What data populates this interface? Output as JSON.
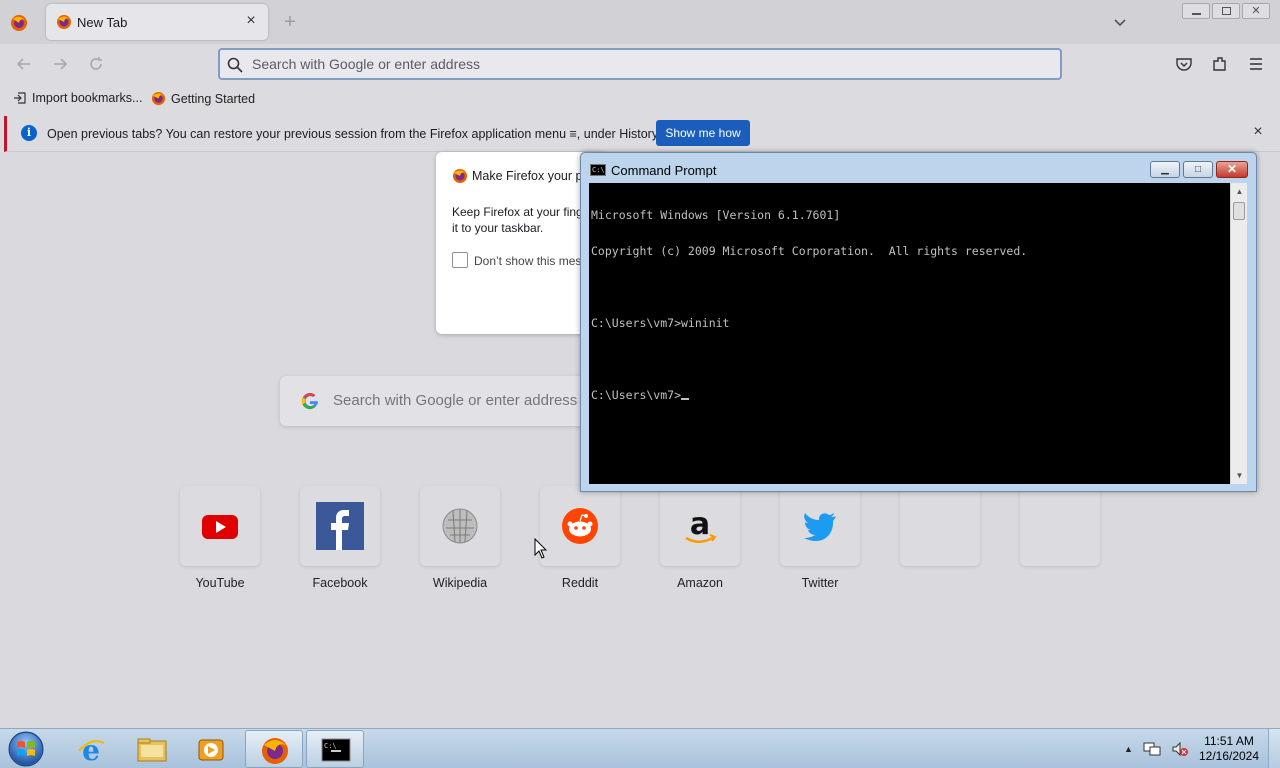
{
  "firefox": {
    "tab": {
      "title": "New Tab"
    },
    "urlbar": {
      "placeholder": "Search with Google or enter address"
    },
    "bookmarks": [
      {
        "label": "Import bookmarks..."
      },
      {
        "label": "Getting Started"
      }
    ],
    "notification": {
      "message": "Open previous tabs? You can restore your previous session from the Firefox application menu ≡, under History.",
      "button": "Show me how"
    },
    "default_browser_dialog": {
      "title": "Make Firefox your pr",
      "body_line1": "Keep Firefox at your fing",
      "body_line2": "it to your taskbar.",
      "checkbox_label": "Don’t show this mes"
    },
    "newtab_search": {
      "placeholder": "Search with Google or enter address"
    },
    "top_sites": [
      {
        "label": "YouTube",
        "icon": "youtube-icon"
      },
      {
        "label": "Facebook",
        "icon": "facebook-icon"
      },
      {
        "label": "Wikipedia",
        "icon": "wikipedia-icon"
      },
      {
        "label": "Reddit",
        "icon": "reddit-icon"
      },
      {
        "label": "Amazon",
        "icon": "amazon-icon"
      },
      {
        "label": "Twitter",
        "icon": "twitter-icon"
      },
      {
        "label": ""
      },
      {
        "label": ""
      }
    ]
  },
  "cmd": {
    "title": "Command Prompt",
    "lines": [
      "Microsoft Windows [Version 6.1.7601]",
      "Copyright (c) 2009 Microsoft Corporation.  All rights reserved.",
      "",
      "C:\\Users\\vm7>wininit",
      "",
      "C:\\Users\\vm7>"
    ]
  },
  "taskbar": {
    "items": [
      "start-orb",
      "internet-explorer-icon",
      "file-explorer-icon",
      "media-player-icon",
      "firefox-icon",
      "command-prompt-icon"
    ],
    "clock": {
      "time": "11:51 AM",
      "date": "12/16/2024"
    }
  },
  "colors": {
    "accent": "#1b5dbb",
    "notice_border": "#c4132d",
    "console_bg": "#000000"
  }
}
